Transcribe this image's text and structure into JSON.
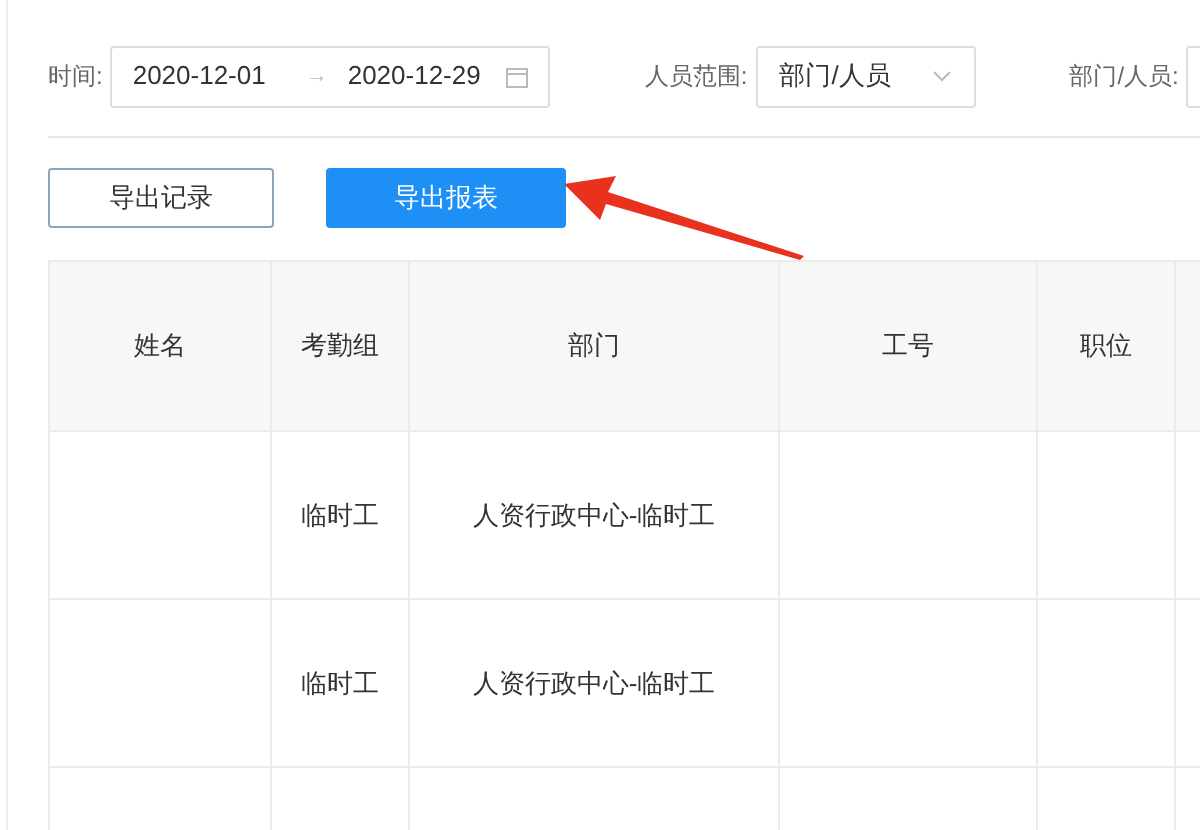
{
  "filters": {
    "time_label": "时间:",
    "start_date": "2020-12-01",
    "date_separator": "→",
    "end_date": "2020-12-29",
    "scope_label": "人员范围:",
    "scope_value": "部门/人员",
    "department_label": "部门/人员:"
  },
  "buttons": [
    {
      "label": "导出记录",
      "kind": "outline"
    },
    {
      "label": "导出报表",
      "kind": "primary"
    }
  ],
  "table": {
    "columns": [
      "姓名",
      "考勤组",
      "部门",
      "工号",
      "职位"
    ],
    "rows": [
      {
        "group": "临时工",
        "department": "人资行政中心-临时工"
      },
      {
        "group": "临时工",
        "department": "人资行政中心-临时工"
      }
    ]
  }
}
